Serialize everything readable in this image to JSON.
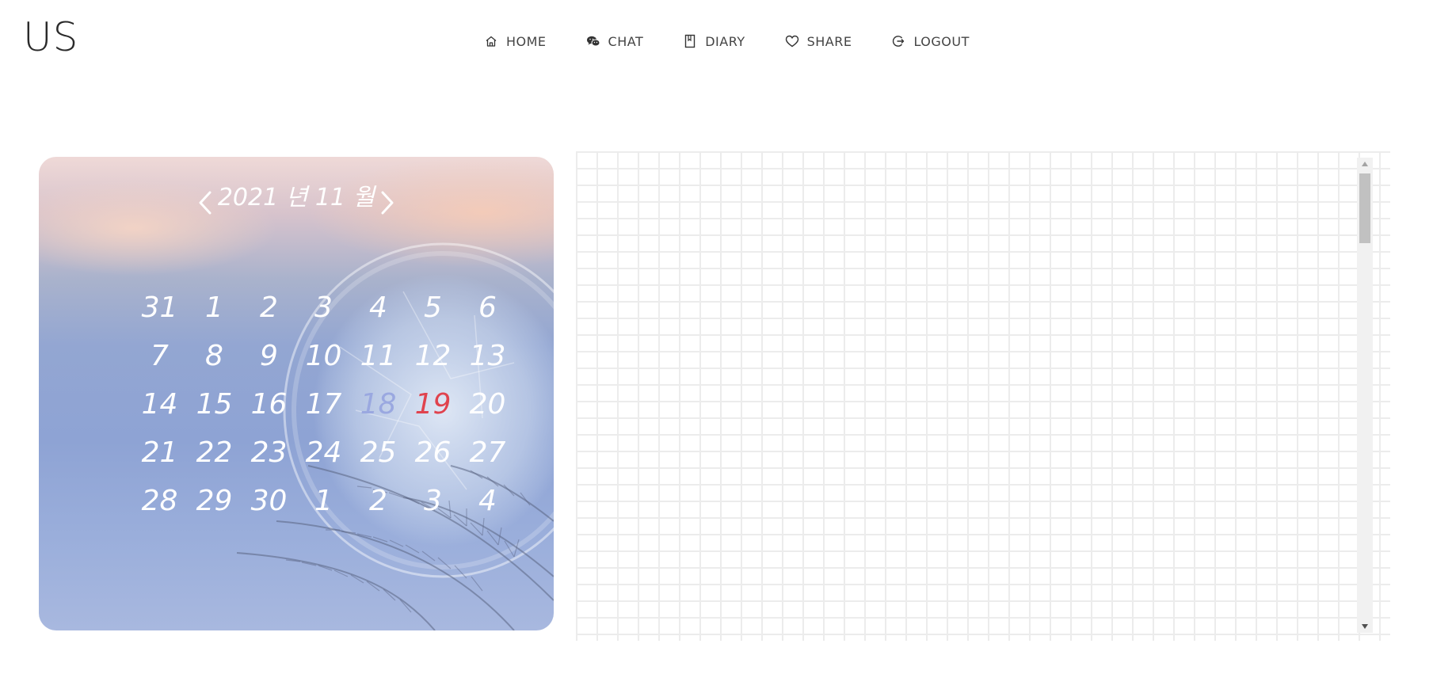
{
  "app": {
    "logo": "US"
  },
  "nav": {
    "items": [
      {
        "label": "HOME",
        "icon": "home-icon"
      },
      {
        "label": "CHAT",
        "icon": "chat-icon"
      },
      {
        "label": "DIARY",
        "icon": "diary-icon"
      },
      {
        "label": "SHARE",
        "icon": "heart-icon"
      },
      {
        "label": "LOGOUT",
        "icon": "logout-icon"
      }
    ]
  },
  "calendar": {
    "title": "2021 년 11 월",
    "prev_label": "<",
    "next_label": ">",
    "weeks": [
      [
        "31",
        "1",
        "2",
        "3",
        "4",
        "5",
        "6"
      ],
      [
        "7",
        "8",
        "9",
        "10",
        "11",
        "12",
        "13"
      ],
      [
        "14",
        "15",
        "16",
        "17",
        "18",
        "19",
        "20"
      ],
      [
        "21",
        "22",
        "23",
        "24",
        "25",
        "26",
        "27"
      ],
      [
        "28",
        "29",
        "30",
        "1",
        "2",
        "3",
        "4"
      ]
    ],
    "highlight_today": "18",
    "highlight_selected": "19",
    "colors": {
      "day": "#ffffff",
      "today": "#9aa8e0",
      "selected": "#e0434e"
    }
  },
  "panel": {
    "grid_color": "#ececec",
    "scrollbar_position": 0.0
  }
}
